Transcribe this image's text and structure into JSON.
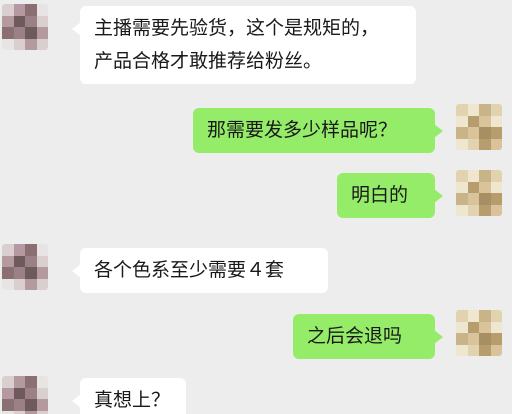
{
  "conversation": {
    "messages": [
      {
        "sender": "other",
        "lines": [
          "主播需要先验货，这个是规矩的，",
          "产品合格才敢推荐给粉丝。"
        ]
      },
      {
        "sender": "self",
        "lines": [
          "那需要发多少样品呢？"
        ]
      },
      {
        "sender": "self",
        "lines": [
          "明白的"
        ]
      },
      {
        "sender": "other",
        "lines": [
          "各个色系至少需要４套"
        ]
      },
      {
        "sender": "self",
        "lines": [
          "之后会退吗"
        ]
      },
      {
        "sender": "other",
        "lines": [
          "真想上？"
        ]
      }
    ]
  },
  "colors": {
    "background": "#ededed",
    "incoming_bubble": "#ffffff",
    "outgoing_bubble": "#95ec69",
    "text": "#191919",
    "avatar_other_palette": [
      "#6e5a5a",
      "#8a6f73",
      "#b49aa0",
      "#d9cfcf",
      "#e9e4e4",
      "#9c8087"
    ],
    "avatar_self_palette": [
      "#c9b48a",
      "#e2d3b0",
      "#b79c6e",
      "#efe6d0",
      "#a88f63",
      "#d8c39a"
    ]
  },
  "avatars": {
    "other_icon": "pixelated-avatar-icon",
    "self_icon": "pixelated-avatar-icon"
  }
}
